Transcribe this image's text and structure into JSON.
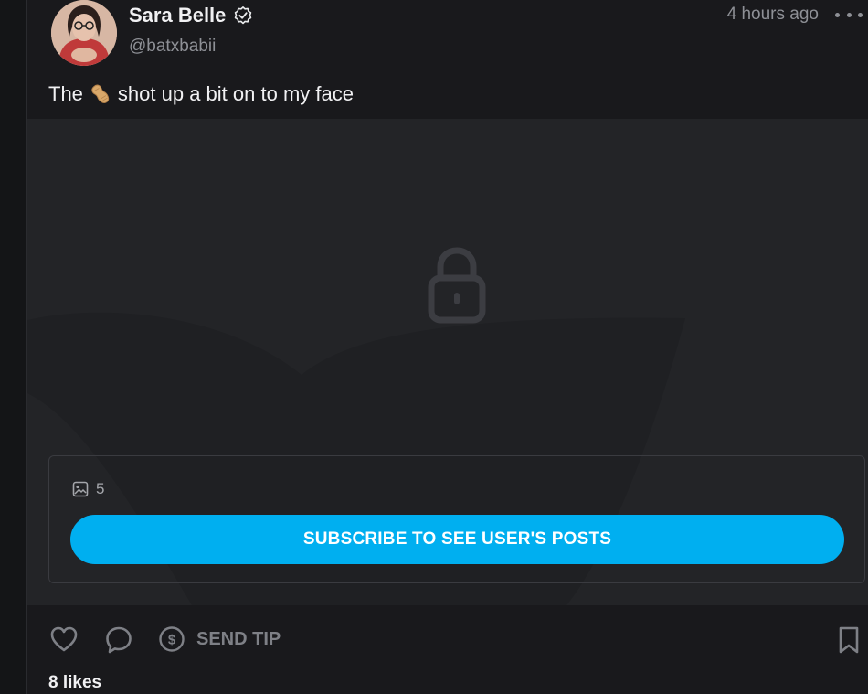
{
  "post": {
    "author": {
      "name": "Sara Belle",
      "handle": "@batxbabii",
      "verified": true
    },
    "timestamp": "4 hours ago",
    "caption_before": "The",
    "caption_emoji": "peanut",
    "caption_after": "shot up a bit on to my face",
    "media_count": "5",
    "subscribe_label": "SUBSCRIBE TO SEE USER'S POSTS",
    "send_tip_label": "SEND TIP",
    "likes": "8 likes"
  },
  "colors": {
    "accent": "#00aff0",
    "background": "#19191c",
    "media_bg": "#232427",
    "muted_text": "#8e9096"
  },
  "icons": [
    "verified-icon",
    "more-icon",
    "lock-icon",
    "image-icon",
    "heart-icon",
    "comment-icon",
    "dollar-icon",
    "bookmark-icon"
  ]
}
